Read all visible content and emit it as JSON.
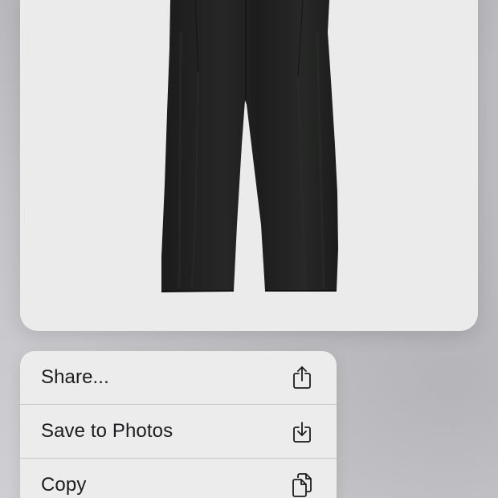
{
  "preview": {
    "image_subject": "black pleated trousers",
    "background_color": "#ebebeb",
    "garment_color": "#1f201f"
  },
  "context_menu": {
    "items": [
      {
        "label": "Share...",
        "icon": "share-icon"
      },
      {
        "label": "Save to Photos",
        "icon": "save-to-photos-icon"
      },
      {
        "label": "Copy",
        "icon": "copy-icon"
      }
    ]
  },
  "colors": {
    "menu_background": "#ececed",
    "menu_text": "#1c1c1e",
    "divider": "#c8c8cc"
  }
}
